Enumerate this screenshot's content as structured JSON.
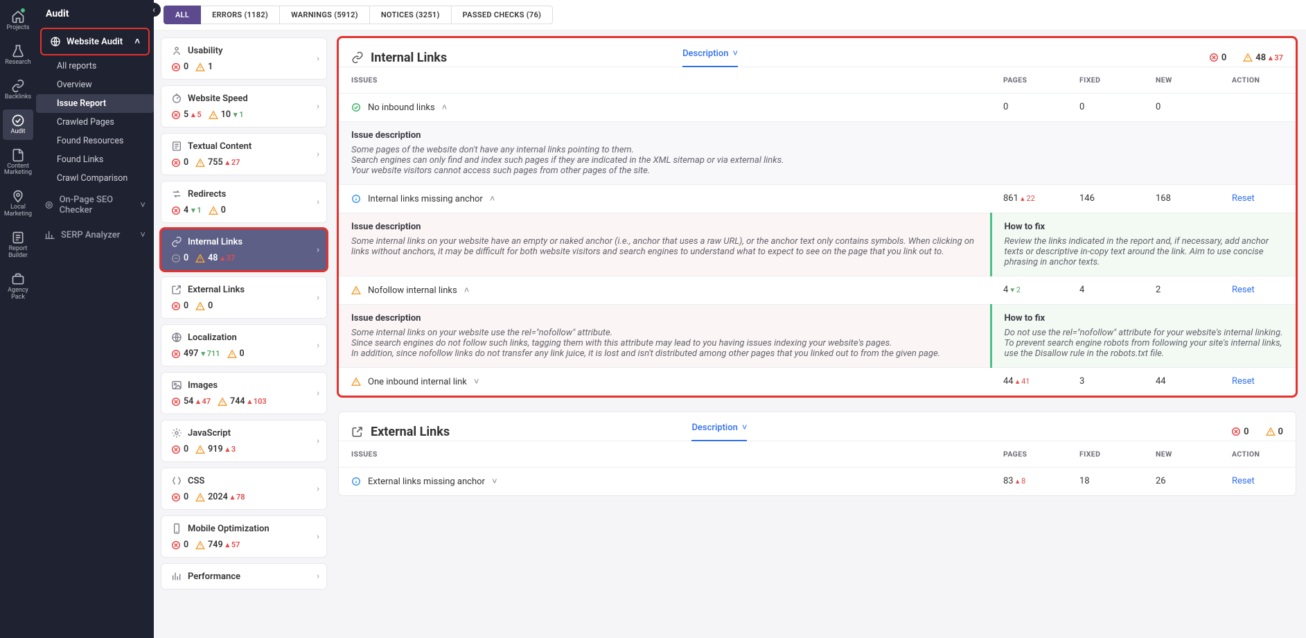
{
  "rail": [
    {
      "id": "projects",
      "label": "Projects",
      "dot": true
    },
    {
      "id": "research",
      "label": "Research"
    },
    {
      "id": "backlinks",
      "label": "Backlinks"
    },
    {
      "id": "audit",
      "label": "Audit",
      "active": true
    },
    {
      "id": "content",
      "label": "Content Marketing"
    },
    {
      "id": "local",
      "label": "Local Marketing"
    },
    {
      "id": "report",
      "label": "Report Builder"
    },
    {
      "id": "agency",
      "label": "Agency Pack"
    }
  ],
  "sidebar": {
    "title": "Audit",
    "website_audit": "Website Audit",
    "items": [
      {
        "label": "All reports"
      },
      {
        "label": "Overview"
      },
      {
        "label": "Issue Report",
        "active": true
      },
      {
        "label": "Crawled Pages"
      },
      {
        "label": "Found Resources"
      },
      {
        "label": "Found Links"
      },
      {
        "label": "Crawl Comparison"
      }
    ],
    "onpage": "On-Page SEO Checker",
    "serp": "SERP Analyzer"
  },
  "tabs": [
    {
      "label": "ALL",
      "active": true
    },
    {
      "label": "ERRORS (1182)"
    },
    {
      "label": "WARNINGS (5912)"
    },
    {
      "label": "NOTICES (3251)"
    },
    {
      "label": "PASSED CHECKS (76)"
    }
  ],
  "categories": [
    {
      "key": "usability",
      "name": "Usability",
      "err": "0",
      "warn": "1"
    },
    {
      "key": "speed",
      "name": "Website Speed",
      "err": "5",
      "err_d": "▴ 5",
      "warn": "10",
      "warn_d": "▾ 1"
    },
    {
      "key": "textual",
      "name": "Textual Content",
      "err": "0",
      "warn": "755",
      "warn_d": "▴ 27"
    },
    {
      "key": "redirects",
      "name": "Redirects",
      "err": "4",
      "err_d": "▾ 1",
      "warn": "0"
    },
    {
      "key": "internal",
      "name": "Internal Links",
      "stop": "0",
      "warn": "48",
      "warn_d": "▴ 37",
      "selected": true,
      "hl": true
    },
    {
      "key": "external",
      "name": "External Links",
      "err": "0",
      "warn": "0"
    },
    {
      "key": "localization",
      "name": "Localization",
      "err": "497",
      "err_d": "▾ 711",
      "warn": "0"
    },
    {
      "key": "images",
      "name": "Images",
      "err": "54",
      "err_d": "▴ 47",
      "warn": "744",
      "warn_d": "▴ 103"
    },
    {
      "key": "javascript",
      "name": "JavaScript",
      "err": "0",
      "warn": "919",
      "warn_d": "▴ 3"
    },
    {
      "key": "css",
      "name": "CSS",
      "err": "0",
      "warn": "2024",
      "warn_d": "▴ 78"
    },
    {
      "key": "mobile",
      "name": "Mobile Optimization",
      "err": "0",
      "warn": "749",
      "warn_d": "▴ 57"
    },
    {
      "key": "performance",
      "name": "Performance"
    }
  ],
  "internal_links": {
    "title": "Internal Links",
    "description_label": "Description",
    "head_err": "0",
    "head_warn": "48",
    "head_warn_d": "▴ 37",
    "cols": {
      "issues": "ISSUES",
      "pages": "PAGES",
      "fixed": "FIXED",
      "new": "NEW",
      "action": "ACTION"
    },
    "rows": [
      {
        "icon": "ok",
        "name": "No inbound links",
        "pages": "0",
        "fixed": "0",
        "new": "0",
        "reset": "",
        "expanded": true,
        "desc_title": "Issue description",
        "desc": "Some pages of the website don't have any internal links pointing to them.\nSearch engines can only find and index such pages if they are indicated in the XML sitemap or via external links.\nYour website visitors cannot access such pages from other pages of the site."
      },
      {
        "icon": "info",
        "name": "Internal links missing anchor",
        "pages": "861",
        "pages_d": "▴ 22",
        "fixed": "146",
        "new": "168",
        "reset": "Reset",
        "expanded": true,
        "split": true,
        "desc_title": "Issue description",
        "desc": "Some internal links on your website have an empty or naked anchor (i.e., anchor that uses a raw URL), or the anchor text only contains symbols. When clicking on links without anchors, it may be difficult for both website visitors and search engines to understand what to expect to see on the page that you link out to.",
        "fix_title": "How to fix",
        "fix": "Review the links indicated in the report and, if necessary, add anchor texts or descriptive in-copy text around the link. Aim to use concise phrasing in anchor texts."
      },
      {
        "icon": "warn",
        "name": "Nofollow internal links",
        "pages": "4",
        "pages_d": "▾ 2",
        "fixed": "4",
        "new": "2",
        "reset": "Reset",
        "expanded": true,
        "split": true,
        "desc_title": "Issue description",
        "desc": "Some internal links on your website use the rel=\"nofollow\" attribute.\nSince search engines do not follow such links, tagging them with this attribute may lead to you having issues indexing your website's pages.\nIn addition, since nofollow links do not transfer any link juice, it is lost and isn't distributed among other pages that you linked out to from the given page.",
        "fix_title": "How to fix",
        "fix": "Do not use the rel=\"nofollow\" attribute for your website's internal linking.\nTo prevent search engine robots from following your site's internal links, use the Disallow rule in the robots.txt file."
      },
      {
        "icon": "warn",
        "name": "One inbound internal link",
        "pages": "44",
        "pages_d": "▴ 41",
        "fixed": "3",
        "new": "44",
        "reset": "Reset"
      }
    ]
  },
  "external_links": {
    "title": "External Links",
    "description_label": "Description",
    "head_err": "0",
    "head_warn": "0",
    "cols": {
      "issues": "ISSUES",
      "pages": "PAGES",
      "fixed": "FIXED",
      "new": "NEW",
      "action": "ACTION"
    },
    "rows": [
      {
        "icon": "info",
        "name": "External links missing anchor",
        "pages": "83",
        "pages_d": "▴ 8",
        "fixed": "18",
        "new": "26",
        "reset": "Reset"
      }
    ]
  }
}
